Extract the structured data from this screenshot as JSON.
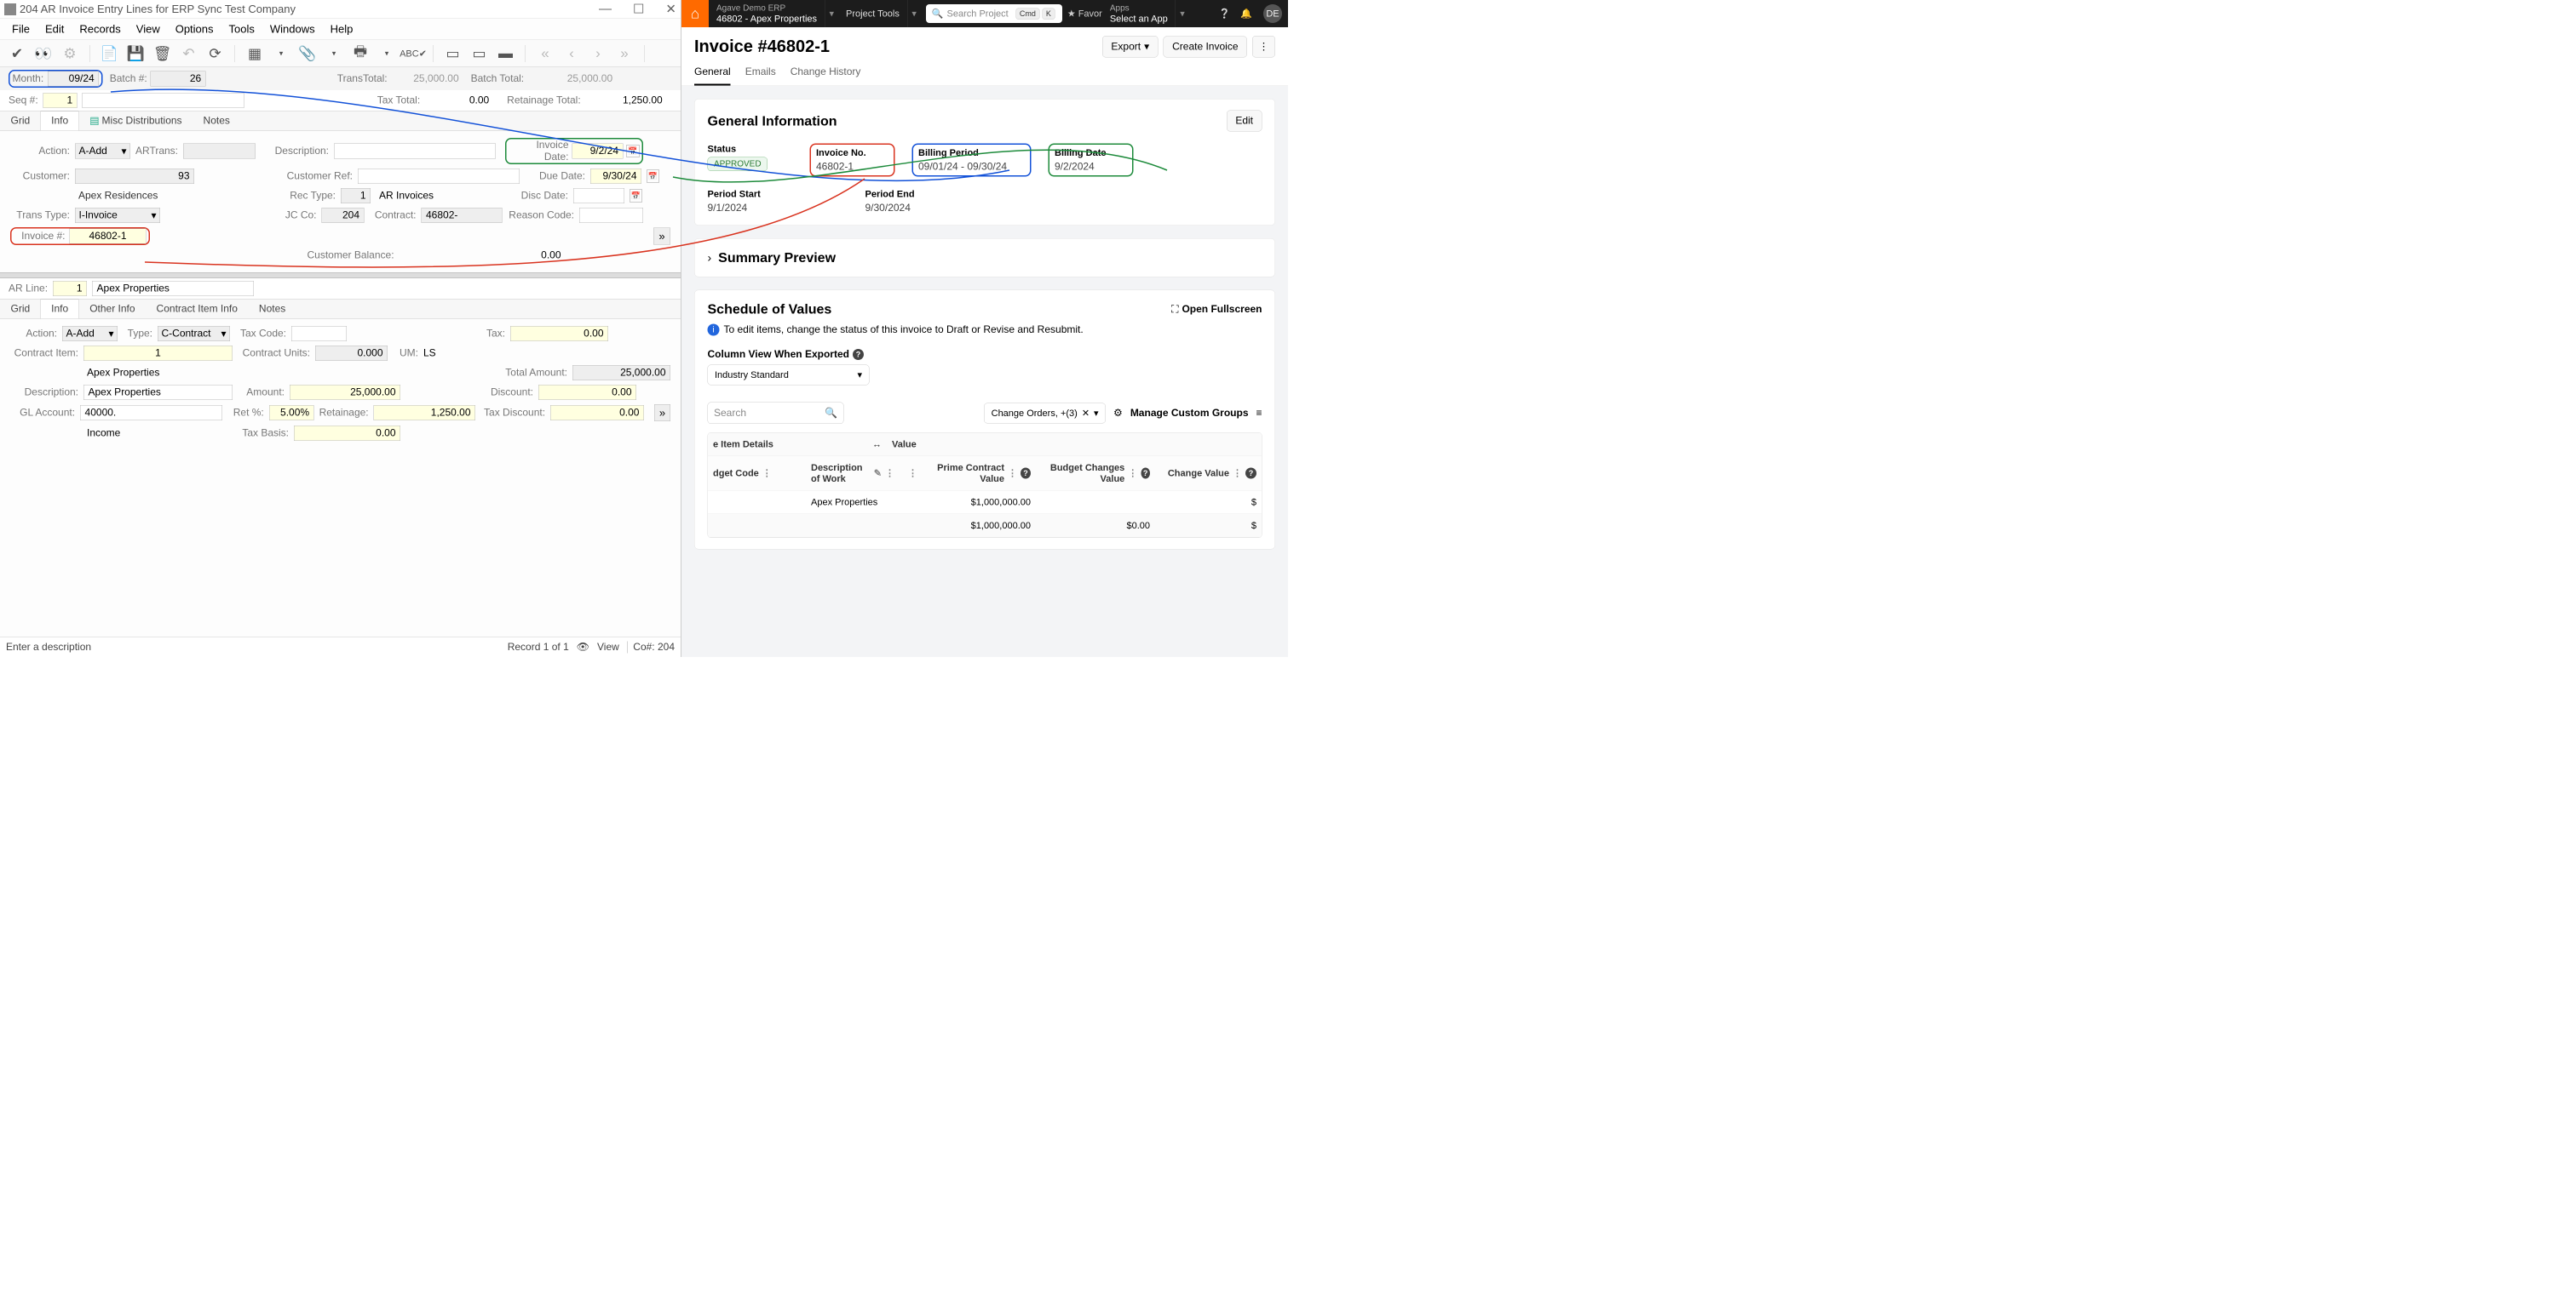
{
  "left": {
    "title": "204 AR Invoice Entry Lines for ERP Sync Test Company",
    "menus": [
      "File",
      "Edit",
      "Records",
      "View",
      "Options",
      "Tools",
      "Windows",
      "Help"
    ],
    "header": {
      "month_label": "Month:",
      "month": "09/24",
      "batch_label": "Batch #:",
      "batch": "26",
      "transtotal_label": "TransTotal:",
      "transtotal": "25,000.00",
      "batchtotal_label": "Batch Total:",
      "batchtotal": "25,000.00",
      "seq_label": "Seq #:",
      "seq": "1",
      "taxtotal_label": "Tax Total:",
      "taxtotal": "0.00",
      "retainage_label": "Retainage Total:",
      "retainage": "1,250.00"
    },
    "top_tabs": {
      "grid": "Grid",
      "info": "Info",
      "misc": "Misc Distributions",
      "notes": "Notes"
    },
    "form": {
      "action_label": "Action:",
      "action": "A-Add",
      "artrans_label": "ARTrans:",
      "customer_label": "Customer:",
      "customer": "93",
      "customer_name": "Apex Residences",
      "transtype_label": "Trans Type:",
      "transtype": "I-Invoice",
      "invoice_label": "Invoice #:",
      "invoice": "46802-1",
      "desc_label": "Description:",
      "custref_label": "Customer Ref:",
      "rectype_label": "Rec Type:",
      "rectype": "1",
      "rectype_name": "AR Invoices",
      "jcco_label": "JC Co:",
      "jcco": "204",
      "contract_label": "Contract:",
      "contract": "46802-",
      "invdate_label": "Invoice Date:",
      "invdate": "9/2/24",
      "duedate_label": "Due Date:",
      "duedate": "9/30/24",
      "discdate_label": "Disc Date:",
      "reason_label": "Reason Code:",
      "custbal_label": "Customer Balance:",
      "custbal": "0.00"
    },
    "line": {
      "arline_label": "AR Line:",
      "arline": "1",
      "arline_name": "Apex Properties",
      "tabs": {
        "grid": "Grid",
        "info": "Info",
        "other": "Other Info",
        "contract": "Contract Item Info",
        "notes": "Notes"
      },
      "action_label": "Action:",
      "action": "A-Add",
      "type_label": "Type:",
      "type": "C-Contract",
      "taxcode_label": "Tax Code:",
      "tax_label": "Tax:",
      "tax": "0.00",
      "contractitem_label": "Contract Item:",
      "contractitem": "1",
      "contractitem_name": "Apex Properties",
      "contractunits_label": "Contract Units:",
      "contractunits": "0.000",
      "um_label": "UM:",
      "um": "LS",
      "totalamount_label": "Total Amount:",
      "totalamount": "25,000.00",
      "desc_label": "Description:",
      "desc": "Apex Properties",
      "amount_label": "Amount:",
      "amount": "25,000.00",
      "discount_label": "Discount:",
      "discount": "0.00",
      "gl_label": "GL Account:",
      "gl": "40000.",
      "retpct_label": "Ret %:",
      "retpct": "5.00%",
      "retainage_label": "Retainage:",
      "retainage": "1,250.00",
      "taxdisc_label": "Tax Discount:",
      "taxdisc": "0.00",
      "income": "Income",
      "taxbasis_label": "Tax Basis:",
      "taxbasis": "0.00"
    },
    "status": {
      "hint": "Enter a description",
      "record": "Record 1 of 1",
      "view": "View",
      "co": "Co#: 204"
    }
  },
  "right": {
    "nav": {
      "company": "Agave Demo ERP",
      "project": "46802 - Apex Properties",
      "tools": "Project Tools",
      "search_ph": "Search Project",
      "cmd": "Cmd",
      "k": "K",
      "favor": "Favor",
      "apps": "Apps",
      "select_app": "Select an App",
      "avatar": "DE"
    },
    "page": {
      "title": "Invoice #46802-1",
      "export": "Export",
      "create": "Create Invoice",
      "tabs": [
        "General",
        "Emails",
        "Change History"
      ]
    },
    "general": {
      "heading": "General Information",
      "edit": "Edit",
      "status_k": "Status",
      "status_v": "APPROVED",
      "inv_k": "Invoice No.",
      "inv_v": "46802-1",
      "period_k": "Billing Period",
      "period_v": "09/01/24 - 09/30/24",
      "bdate_k": "Billing Date",
      "bdate_v": "9/2/2024",
      "pstart_k": "Period Start",
      "pstart_v": "9/1/2024",
      "pend_k": "Period End",
      "pend_v": "9/30/2024"
    },
    "summary": {
      "heading": "Summary Preview"
    },
    "sov": {
      "heading": "Schedule of Values",
      "fullscreen": "Open Fullscreen",
      "hint": "To edit items, change the status of this invoice to Draft or Revise and Resubmit.",
      "colview_label": "Column View When Exported",
      "colview": "Industry Standard",
      "search_ph": "Search",
      "chip": "Change Orders, +(3)",
      "manage": "Manage Custom Groups",
      "h_item": "e Item Details",
      "h_value": "Value",
      "h_budget": "dget Code",
      "h_dow": "Description of Work",
      "h_pcv": "Prime Contract Value",
      "h_bcv": "Budget Changes Value",
      "h_cv": "Change Value",
      "row1_desc": "Apex Properties",
      "row1_pcv": "$1,000,000.00",
      "row1_cv": "$",
      "row2_pcv": "$1,000,000.00",
      "row2_bcv": "$0.00",
      "row2_cv": "$"
    }
  }
}
